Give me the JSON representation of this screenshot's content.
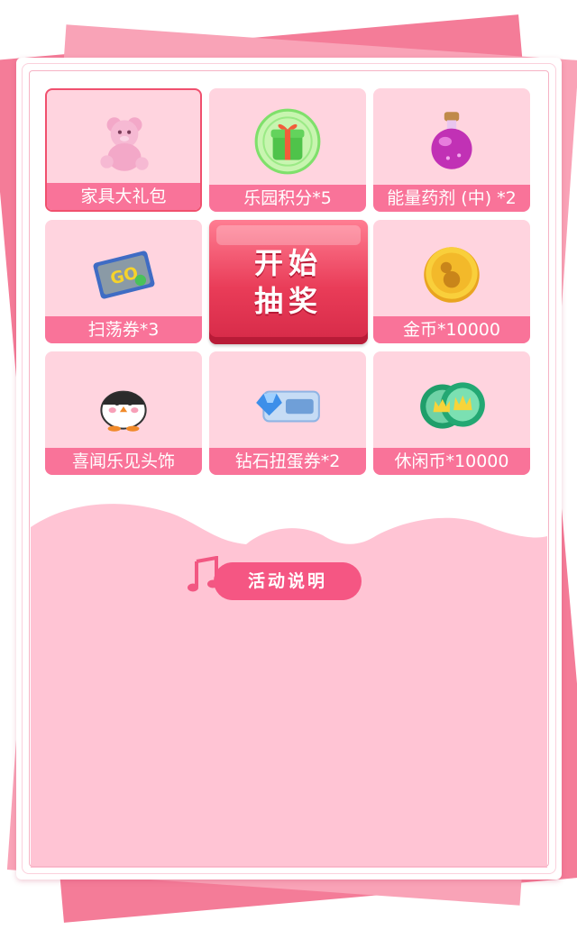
{
  "prizes": [
    {
      "label": "家具大礼包",
      "icon": "teddy-bear-icon"
    },
    {
      "label": "乐园积分*5",
      "icon": "gift-box-icon"
    },
    {
      "label": "能量药剂 (中) *2",
      "icon": "potion-icon"
    },
    {
      "label": "扫荡券*3",
      "icon": "go-ticket-icon"
    },
    {
      "label": "金币*10000",
      "icon": "gold-coin-icon"
    },
    {
      "label": "喜闻乐见头饰",
      "icon": "penguin-hat-icon"
    },
    {
      "label": "钻石扭蛋券*2",
      "icon": "diamond-ticket-icon"
    },
    {
      "label": "休闲币*10000",
      "icon": "leisure-coin-icon"
    }
  ],
  "start_button": {
    "line1": "开始",
    "line2": "抽奖"
  },
  "rules_button": {
    "label": "活动说明"
  },
  "colors": {
    "accent": "#f97399",
    "start": "#e93c58",
    "cell_bg": "#ffd4df",
    "cloud": "#ffc4d4"
  }
}
